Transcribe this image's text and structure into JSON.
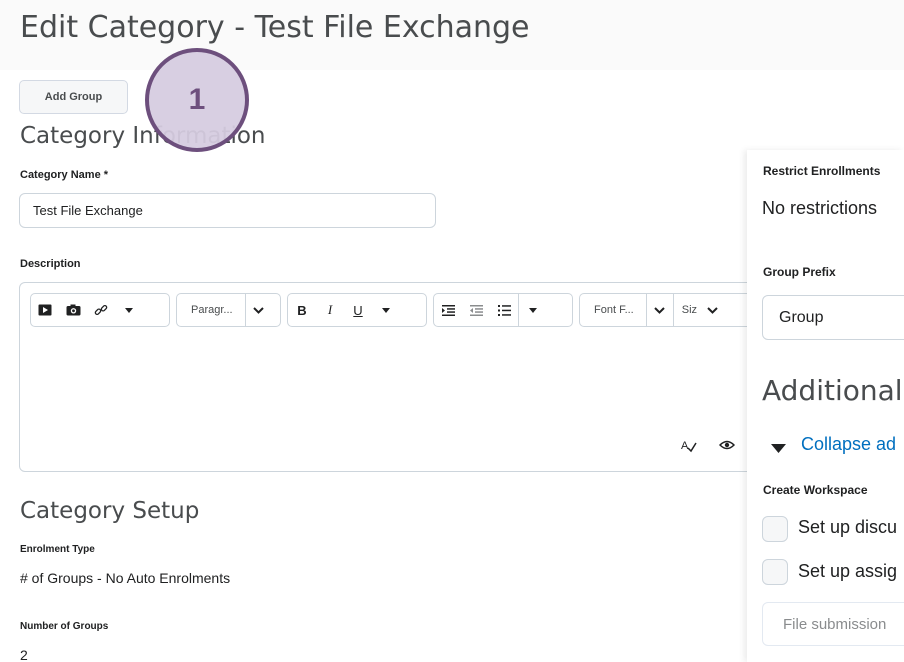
{
  "page": {
    "title": "Edit Category - Test File Exchange"
  },
  "toolbar": {
    "add_group_label": "Add Group"
  },
  "callout": {
    "number": "1"
  },
  "category_info": {
    "heading": "Category Information",
    "name_label": "Category Name *",
    "name_value": "Test File Exchange",
    "description_label": "Description"
  },
  "editor": {
    "paragraph_label": "Paragr...",
    "bold": "B",
    "italic": "I",
    "underline": "U",
    "font_family_label": "Font F...",
    "size_label": "Siz"
  },
  "category_setup": {
    "heading": "Category Setup",
    "enrolment_type_label": "Enrolment Type",
    "enrolment_type_value": "# of Groups - No Auto Enrolments",
    "num_groups_label": "Number of Groups",
    "num_groups_value": "2"
  },
  "right_panel": {
    "restrict_label": "Restrict Enrollments",
    "restrict_value": "No restrictions",
    "prefix_label": "Group Prefix",
    "prefix_value": "Group",
    "additional_heading": "Additional",
    "collapse_link": "Collapse ad",
    "workspace_label": "Create Workspace",
    "discussions_option": "Set up discu",
    "assignments_option": "Set up assig",
    "file_submission_placeholder": "File submission"
  },
  "colors": {
    "accent": "#006fbf",
    "callout": "#6d4f7d",
    "heading": "#494c4e"
  }
}
